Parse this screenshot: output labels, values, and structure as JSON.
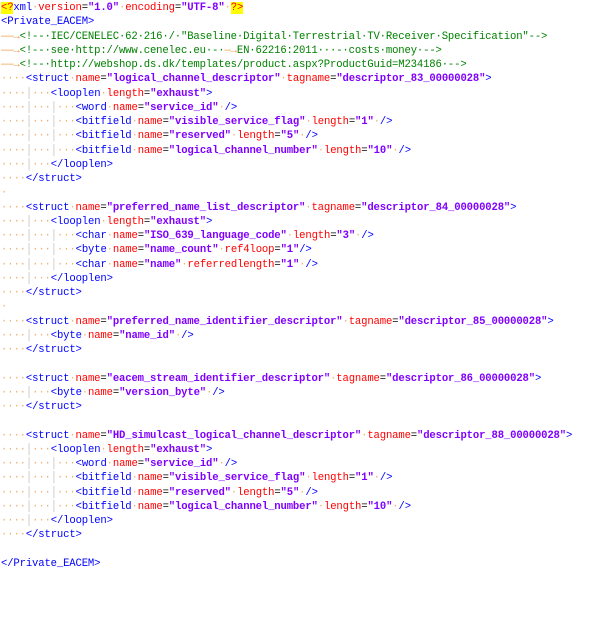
{
  "document": {
    "xml_decl": {
      "version": "1.0",
      "encoding": "UTF-8"
    },
    "root": "Private_EACEM",
    "comments": [
      " IEC/CENELEC 62 216 / \"Baseline Digital Terrestrial TV Receiver Specification\"",
      " see http://www.cenelec.eu -  EN 62216:2011   - costs money ",
      " http://webshop.ds.dk/templates/product.aspx?ProductGuid=M234186 "
    ],
    "structs": [
      {
        "name": "logical_channel_descriptor",
        "tagname": "descriptor_83_00000028",
        "looplen": "exhaust",
        "fields": [
          {
            "type": "word",
            "name": "service_id"
          },
          {
            "type": "bitfield",
            "name": "visible_service_flag",
            "length": "1"
          },
          {
            "type": "bitfield",
            "name": "reserved",
            "length": "5"
          },
          {
            "type": "bitfield",
            "name": "logical_channel_number",
            "length": "10"
          }
        ]
      },
      {
        "name": "preferred_name_list_descriptor",
        "tagname": "descriptor_84_00000028",
        "looplen": "exhaust",
        "fields": [
          {
            "type": "char",
            "name": "ISO_639_language_code",
            "length": "3"
          },
          {
            "type": "byte",
            "name": "name_count",
            "ref4loop": "1"
          },
          {
            "type": "char",
            "name": "name",
            "referredlength": "1"
          }
        ]
      },
      {
        "name": "preferred_name_identifier_descriptor",
        "tagname": "descriptor_85_00000028",
        "fields": [
          {
            "type": "byte",
            "name": "name_id"
          }
        ]
      },
      {
        "name": "eacem_stream_identifier_descriptor",
        "tagname": "descriptor_86_00000028",
        "fields": [
          {
            "type": "byte",
            "name": "version_byte"
          }
        ]
      },
      {
        "name": "HD_simulcast_logical_channel_descriptor",
        "tagname": "descriptor_88_00000028",
        "looplen": "exhaust",
        "fields": [
          {
            "type": "word",
            "name": "service_id"
          },
          {
            "type": "bitfield",
            "name": "visible_service_flag",
            "length": "1"
          },
          {
            "type": "bitfield",
            "name": "reserved",
            "length": "5"
          },
          {
            "type": "bitfield",
            "name": "logical_channel_number",
            "length": "10"
          }
        ]
      }
    ]
  },
  "labels": {
    "xml": "xml",
    "version_attr": "version",
    "encoding_attr": "encoding",
    "struct": "struct",
    "looplen": "looplen",
    "name_attr": "name",
    "tagname_attr": "tagname",
    "length_attr": "length",
    "ref4loop_attr": "ref4loop",
    "referredlength_attr": "referredlength"
  }
}
